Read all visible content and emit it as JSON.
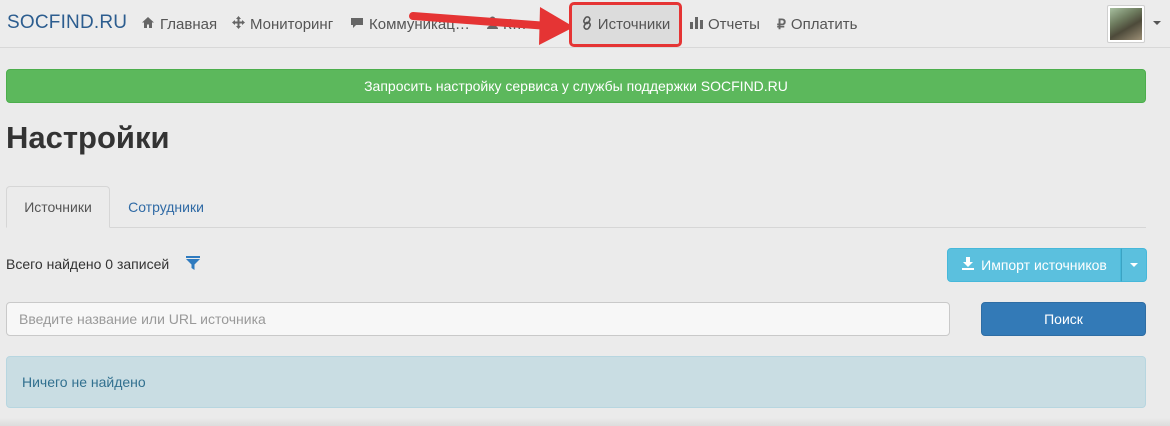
{
  "navbar": {
    "brand": "SOCFIND.RU",
    "items": [
      {
        "label": "Главная",
        "icon": "home-icon"
      },
      {
        "label": "Мониторинг",
        "icon": "move-icon"
      },
      {
        "label": "Коммуникац…",
        "icon": "comment-icon"
      },
      {
        "label": "К…",
        "icon": "user-icon"
      },
      {
        "label": "Источники",
        "icon": "link-icon",
        "active": true
      },
      {
        "label": "Отчеты",
        "icon": "bar-chart-icon"
      },
      {
        "label": "Оплатить",
        "icon": "ruble-icon"
      }
    ],
    "highlight_color": "#e53434"
  },
  "banner": {
    "text": "Запросить настройку сервиса у службы поддержки SOCFIND.RU",
    "color": "#5cb85c"
  },
  "page": {
    "title": "Настройки"
  },
  "tabs": [
    {
      "label": "Источники",
      "active": true
    },
    {
      "label": "Сотрудники",
      "active": false
    }
  ],
  "results": {
    "count_text": "Всего найдено 0 записей"
  },
  "import": {
    "label": "Импорт источников"
  },
  "search": {
    "placeholder": "Введите название или URL источника",
    "value": "",
    "button_label": "Поиск"
  },
  "empty": {
    "message": "Ничего не найдено"
  }
}
